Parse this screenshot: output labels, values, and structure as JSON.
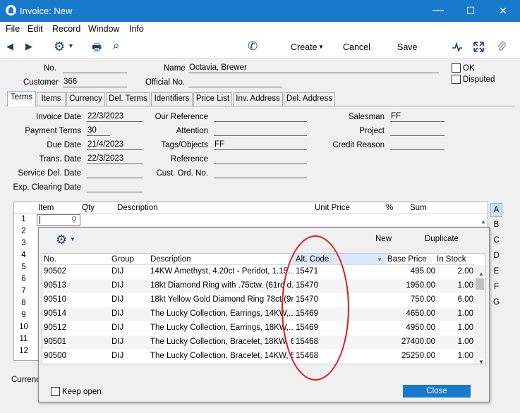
{
  "window": {
    "title": "Invoice: New",
    "minimize": "—",
    "maximize": "☐",
    "close": "✕"
  },
  "menu": [
    "File",
    "Edit",
    "Record",
    "Window",
    "Info"
  ],
  "toolbar": {
    "prev": "◀",
    "next": "▶",
    "gear": "⚙",
    "print": "🖶",
    "search": "⌕",
    "phone": "✆",
    "create_label": "Create",
    "cancel_label": "Cancel",
    "save_label": "Save",
    "icons": [
      "activity-icon",
      "expand-icon",
      "paperclip-icon"
    ]
  },
  "header": {
    "no_label": "No.",
    "no_value": "",
    "name_label": "Name",
    "name_value": "Octavia, Brewer",
    "customer_label": "Customer",
    "customer_value": "366",
    "official_label": "Official No.",
    "official_value": "",
    "ok_label": "OK",
    "disputed_label": "Disputed"
  },
  "tabs": [
    "Terms",
    "Items",
    "Currency",
    "Del. Terms",
    "Identifiers",
    "Price List",
    "Inv. Address",
    "Del. Address"
  ],
  "terms": {
    "invoice_date_label": "Invoice Date",
    "invoice_date": "22/3/2023",
    "payment_terms_label": "Payment Terms",
    "payment_terms": "30",
    "due_date_label": "Due Date",
    "due_date": "21/4/2023",
    "trans_date_label": "Trans. Date",
    "trans_date": "22/3/2023",
    "service_del_label": "Service Del. Date",
    "service_del": "",
    "exp_clearing_label": "Exp. Clearing Date",
    "exp_clearing": "",
    "our_ref_label": "Our Reference",
    "attention_label": "Attention",
    "tags_label": "Tags/Objects",
    "tags_value": "FF",
    "reference_label": "Reference",
    "cust_ord_label": "Cust. Ord. No.",
    "salesman_label": "Salesman",
    "salesman_value": "FF",
    "project_label": "Project",
    "credit_reason_label": "Credit Reason"
  },
  "matrix": {
    "columns": [
      "Item",
      "Qty",
      "Description",
      "Unit Price",
      "%",
      "Sum"
    ],
    "rows": [
      "1",
      "2",
      "3",
      "4",
      "5",
      "6",
      "7",
      "8",
      "9",
      "10",
      "11",
      "12"
    ],
    "side_buttons": [
      "A",
      "B",
      "C",
      "D",
      "E",
      "F",
      "G"
    ]
  },
  "footer": {
    "currency_label": "Currenc"
  },
  "popup": {
    "new_label": "New",
    "duplicate_label": "Duplicate",
    "columns": [
      "No.",
      "Group",
      "Description",
      "Alt. Code",
      "Base Price",
      "In Stock"
    ],
    "rows": [
      {
        "no": "90502",
        "group": "DIJ",
        "desc": "14KW Amethyst, 4.20ct - Peridot, 1.15...",
        "alt": "15471",
        "price": "495.00",
        "stock": "2.00"
      },
      {
        "no": "90513",
        "group": "DIJ",
        "desc": "18kt Diamond Ring with .75ctw. (61rd d...",
        "alt": "15470",
        "price": "1950.00",
        "stock": "1.00"
      },
      {
        "no": "90510",
        "group": "DIJ",
        "desc": "18kt Yellow Gold Diamond Ring 78ct (9rd)",
        "alt": "15470",
        "price": "750.00",
        "stock": "6.00"
      },
      {
        "no": "90514",
        "group": "DIJ",
        "desc": "The Lucky Collection, Earrings, 14KW,...",
        "alt": "15469",
        "price": "4650.00",
        "stock": "1.00"
      },
      {
        "no": "90512",
        "group": "DIJ",
        "desc": "The Lucky Collection, Earrings, 18KW,...",
        "alt": "15469",
        "price": "4950.00",
        "stock": "1.00"
      },
      {
        "no": "90501",
        "group": "DIJ",
        "desc": "The Lucky Collection, Bracelet, 18KW, 6...",
        "alt": "15468",
        "price": "27400.00",
        "stock": "1.00"
      },
      {
        "no": "90500",
        "group": "DIJ",
        "desc": "The Lucky Collection, Bracelet, 14KW, 5...",
        "alt": "15468",
        "price": "25250.00",
        "stock": "1.00"
      }
    ],
    "keep_open_label": "Keep open",
    "close_label": "Close"
  },
  "colors": {
    "accent": "#1979ca",
    "annotation": "#e01a1a"
  }
}
